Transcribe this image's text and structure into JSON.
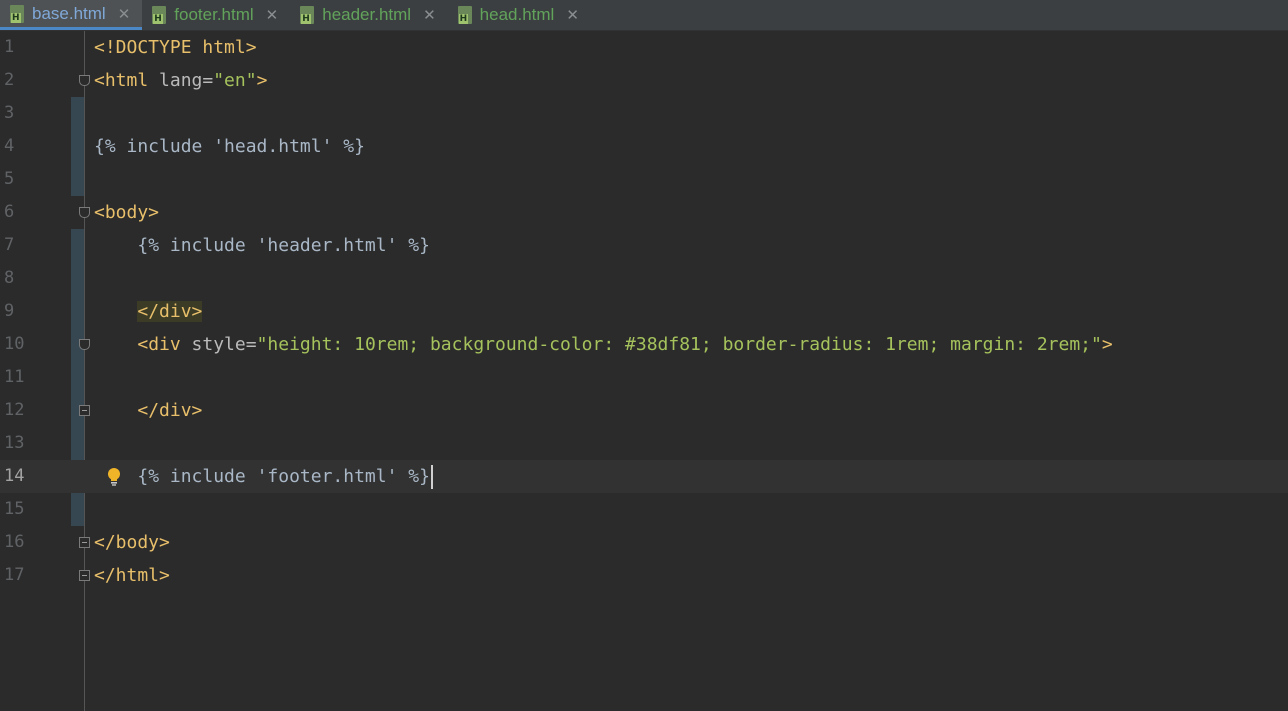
{
  "tabs": [
    {
      "label": "base.html",
      "active": true
    },
    {
      "label": "footer.html",
      "active": false
    },
    {
      "label": "header.html",
      "active": false
    },
    {
      "label": "head.html",
      "active": false
    }
  ],
  "icons": {
    "tab_file": "html-file-icon",
    "tab_close": "close-icon",
    "intention": "lightbulb-icon"
  },
  "colors": {
    "tag": "#e8bf6a",
    "string": "#a5c25c",
    "text": "#a9b7c6",
    "background": "#2b2b2b"
  },
  "current_line": 14,
  "lines": [
    {
      "num": "1",
      "tokens": [
        {
          "t": "<!DOCTYPE html>",
          "c": "tag"
        }
      ]
    },
    {
      "num": "2",
      "tokens": [
        {
          "t": "<html ",
          "c": "tag"
        },
        {
          "t": "lang=",
          "c": "attr"
        },
        {
          "t": "\"en\"",
          "c": "str"
        },
        {
          "t": ">",
          "c": "tag"
        }
      ]
    },
    {
      "num": "3",
      "tokens": []
    },
    {
      "num": "4",
      "tokens": [
        {
          "t": "{% include 'head.html' %}",
          "c": "tpl"
        }
      ]
    },
    {
      "num": "5",
      "tokens": []
    },
    {
      "num": "6",
      "tokens": [
        {
          "t": "<body>",
          "c": "tag"
        }
      ]
    },
    {
      "num": "7",
      "tokens": [
        {
          "t": "    ",
          "c": "tpl"
        },
        {
          "t": "{% include 'header.html' %}",
          "c": "tpl"
        }
      ]
    },
    {
      "num": "8",
      "tokens": []
    },
    {
      "num": "9",
      "tokens": [
        {
          "t": "    ",
          "c": "tpl"
        },
        {
          "t": "</div>",
          "c": "tag hl"
        }
      ]
    },
    {
      "num": "10",
      "tokens": [
        {
          "t": "    ",
          "c": "tpl"
        },
        {
          "t": "<div ",
          "c": "tag"
        },
        {
          "t": "style=",
          "c": "attr"
        },
        {
          "t": "\"height: 10rem; background-color: #38df81; border-radius: 1rem; margin: 2rem;\"",
          "c": "str"
        },
        {
          "t": ">",
          "c": "tag"
        }
      ]
    },
    {
      "num": "11",
      "tokens": []
    },
    {
      "num": "12",
      "tokens": [
        {
          "t": "    ",
          "c": "tpl"
        },
        {
          "t": "</div>",
          "c": "tag"
        }
      ]
    },
    {
      "num": "13",
      "tokens": []
    },
    {
      "num": "14",
      "tokens": [
        {
          "t": "    ",
          "c": "tpl"
        },
        {
          "t": "{% include 'footer.html' %}",
          "c": "tpl"
        }
      ]
    },
    {
      "num": "15",
      "tokens": []
    },
    {
      "num": "16",
      "tokens": [
        {
          "t": "</body>",
          "c": "tag"
        }
      ]
    },
    {
      "num": "17",
      "tokens": [
        {
          "t": "</html>",
          "c": "tag"
        }
      ]
    }
  ]
}
